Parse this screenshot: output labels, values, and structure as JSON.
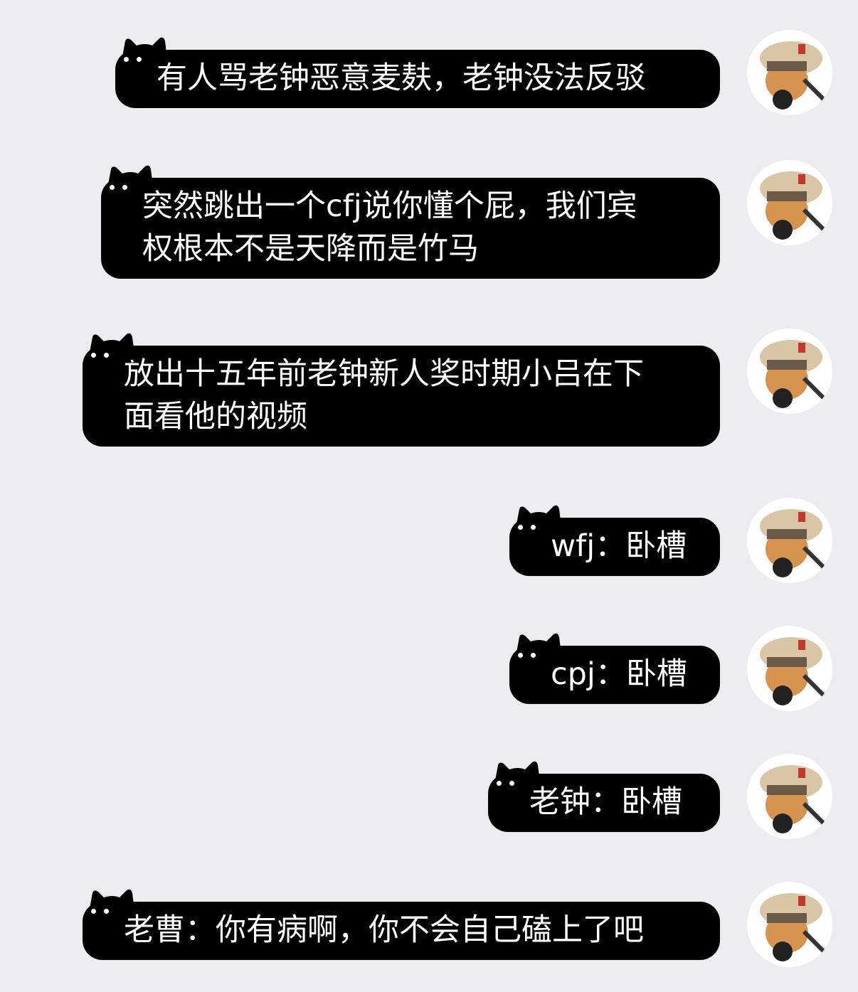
{
  "chat": {
    "messages": [
      {
        "text": "有人骂老钟恶意麦麸，老钟没法反驳"
      },
      {
        "text": "突然跳出一个cfj说你懂个屁，我们宾\n权根本不是天降而是竹马"
      },
      {
        "text": "放出十五年前老钟新人奖时期小吕在下\n面看他的视频"
      },
      {
        "text": "wfj：卧槽"
      },
      {
        "text": "cpj：卧槽"
      },
      {
        "text": "老钟：卧槽"
      },
      {
        "text": "老曹：你有病啊，你不会自己磕上了吧"
      }
    ]
  },
  "colors": {
    "background": "#ededf1",
    "bubble": "#000000",
    "bubble_text": "#ffffff"
  },
  "icons": {
    "avatar": "capybara-with-hat-avatar",
    "bubble_decoration": "cat-ears"
  }
}
